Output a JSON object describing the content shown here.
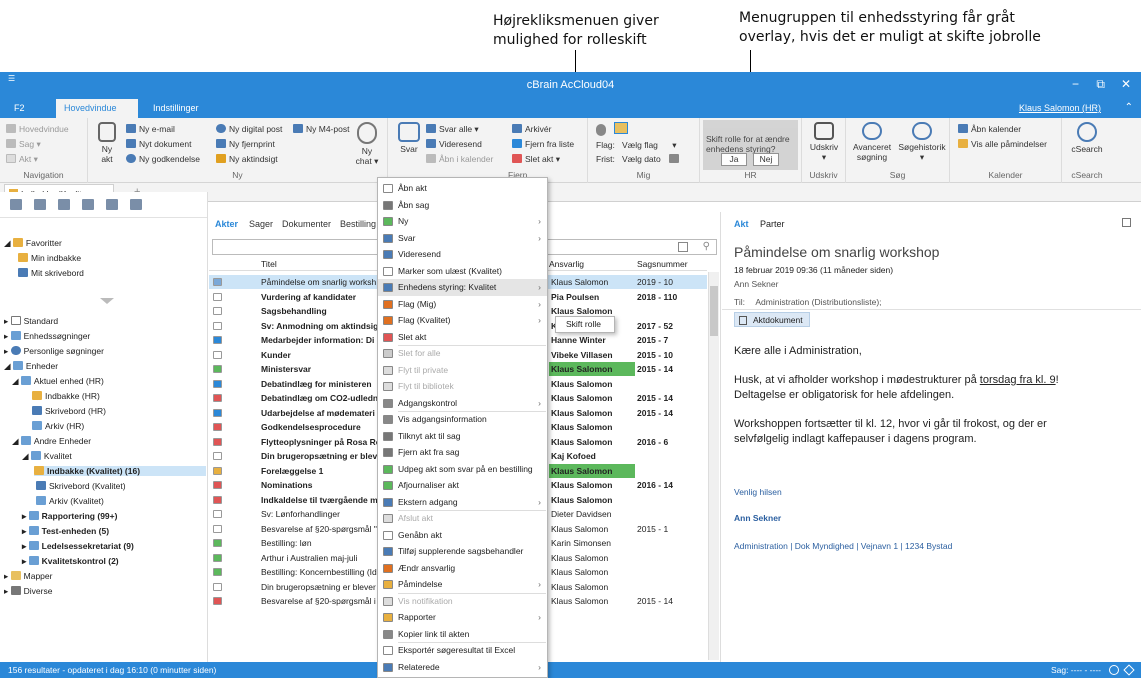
{
  "annotations": {
    "left_line1": "Højrekliksmenuen giver",
    "left_line2": "mulighed for rolleskift",
    "right_line1": "Menugruppen til enhedsstyring får gråt",
    "right_line2": "overlay, hvis det er muligt at skifte jobrolle"
  },
  "window": {
    "title": "cBrain AcCloud04",
    "quick_access": "☰",
    "min": "−",
    "restore": "⧉",
    "close": "✕",
    "collapse": "⌃"
  },
  "tabs": {
    "f2": "F2",
    "hoved": "Hovedvindue",
    "indst": "Indstillinger"
  },
  "user": "Klaus Salomon (HR)",
  "ribbon": {
    "navigation": {
      "label": "Navigation",
      "hovedvindue": "Hovedvindue",
      "sag": "Sag ▾",
      "akt": "Akt ▾"
    },
    "ny": {
      "label": "Ny",
      "ny_akt": "Ny\nakt",
      "email": "Ny e-mail",
      "dokument": "Nyt dokument",
      "godkendelse": "Ny godkendelse",
      "digital": "Ny digital post",
      "m4": "Ny M4-post",
      "fjernprint": "Ny fjernprint",
      "aktindsigt": "Ny aktindsigt",
      "chat": "Ny\nchat ▾"
    },
    "svar": {
      "svar": "Svar",
      "svar_alle": "Svar alle ▾",
      "videresend": "Videresend",
      "aaben_kalender": "Åbn i kalender",
      "arkiver": "Arkivér",
      "fjern_liste": "Fjern fra liste",
      "slet": "Slet akt ▾",
      "fjern": "Fjern"
    },
    "mig": {
      "label": "Mig",
      "flag": "Flag:",
      "vaelg_flag": "Vælg flag",
      "frist": "Frist:",
      "vaelg_dato": "Vælg dato"
    },
    "hr": {
      "label": "HR",
      "text": "Skift rolle for at ændre enhedens styring?",
      "ja": "Ja",
      "nej": "Nej"
    },
    "udskriv": {
      "label": "Udskriv",
      "btn": "Udskriv\n▾"
    },
    "soeg": {
      "label": "Søg",
      "avanceret": "Avanceret\nsøgning",
      "historik": "Søgehistorik\n▾"
    },
    "kalender": {
      "label": "Kalender",
      "aaben": "Åbn kalender",
      "vis": "Vis alle påmindelser"
    },
    "csearch": {
      "label": "cSearch",
      "btn": "cSearch"
    }
  },
  "doc_tab": "Indbakke (Kvalite...",
  "doc_tab_add": "+",
  "tree": {
    "favoritter": "Favoritter",
    "min_indbakke": "Min indbakke",
    "mit_skrivebord": "Mit skrivebord",
    "standard": "Standard",
    "enhedssoegninger": "Enhedssøgninger",
    "personlige": "Personlige søgninger",
    "enheder": "Enheder",
    "aktuel": "Aktuel enhed (HR)",
    "indbakke_hr": "Indbakke (HR)",
    "skrivebord_hr": "Skrivebord (HR)",
    "arkiv_hr": "Arkiv (HR)",
    "andre": "Andre Enheder",
    "kvalitet": "Kvalitet",
    "indbakke_k": "Indbakke (Kvalitet) (16)",
    "skrivebord_k": "Skrivebord (Kvalitet)",
    "arkiv_k": "Arkiv (Kvalitet)",
    "rapportering": "Rapportering (99+)",
    "test": "Test-enheden (5)",
    "ledelse": "Ledelsessekretariat (9)",
    "kvalitetskontrol": "Kvalitetskontrol (2)",
    "mapper": "Mapper",
    "diverse": "Diverse"
  },
  "mid": {
    "tabs": [
      "Akter",
      "Sager",
      "Dokumenter",
      "Bestilling"
    ],
    "col_titel": "Titel",
    "col_ansvarlig": "Ansvarlig",
    "col_sagsnr": "Sagsnummer",
    "rows": [
      {
        "title": "Påmindelse om snarlig worksh",
        "resp": "Klaus Salomon",
        "case": "2019 - 10"
      },
      {
        "title": "Vurdering af kandidater",
        "resp": "Pia Poulsen",
        "case": "2018 - 110"
      },
      {
        "title": "Sagsbehandling",
        "resp": "Klaus Salomon",
        "case": ""
      },
      {
        "title": "Sv: Anmodning om aktindsigt",
        "resp": "Klaus Salomon",
        "case": "2017 - 52"
      },
      {
        "title": "Medarbejder information: Di",
        "resp": "Hanne Winter",
        "case": "2015 - 7"
      },
      {
        "title": "Kunder",
        "resp": "Vibeke Villasen",
        "case": "2015 - 10"
      },
      {
        "title": "Ministersvar",
        "resp": "Klaus Salomon",
        "case": "2015 - 14"
      },
      {
        "title": "Debatindlæg for ministeren",
        "resp": "Klaus Salomon",
        "case": ""
      },
      {
        "title": "Debatindlæg om CO2-udledn",
        "resp": "Klaus Salomon",
        "case": "2015 - 14"
      },
      {
        "title": "Udarbejdelse af mødemateri",
        "resp": "Klaus Salomon",
        "case": "2015 - 14"
      },
      {
        "title": "Godkendelsesprocedure",
        "resp": "Klaus Salomon",
        "case": ""
      },
      {
        "title": "Flytteoplysninger på Rosa Ro",
        "resp": "Klaus Salomon",
        "case": "2016 - 6"
      },
      {
        "title": "Din brugeropsætning er blev",
        "resp": "Kaj Kofoed",
        "case": ""
      },
      {
        "title": "Forelæggelse 1",
        "resp": "Klaus Salomon",
        "case": ""
      },
      {
        "title": "Nominations",
        "resp": "Klaus Salomon",
        "case": "2016 - 14"
      },
      {
        "title": "Indkaldelse til tværgående m",
        "resp": "Klaus Salomon",
        "case": ""
      },
      {
        "title": "Sv: Lønforhandlinger",
        "resp": "Dieter Davidsen",
        "case": ""
      },
      {
        "title": "Besvarelse af §20-spørgsmål \"1",
        "resp": "Klaus Salomon",
        "case": "2015 - 1"
      },
      {
        "title": "Bestilling: løn",
        "resp": "Karin Simonsen",
        "case": ""
      },
      {
        "title": "Arthur i Australien maj-juli",
        "resp": "Klaus Salomon",
        "case": ""
      },
      {
        "title": "Bestilling: Koncernbestilling (Id",
        "resp": "Klaus Salomon",
        "case": ""
      },
      {
        "title": "Din brugeropsætning er blever",
        "resp": "Klaus Salomon",
        "case": ""
      },
      {
        "title": "Besvarelse af §20-spørgsmål i",
        "resp": "Klaus Salomon",
        "case": "2015 - 14"
      }
    ]
  },
  "right": {
    "tab_akt": "Akt",
    "tab_parter": "Parter",
    "subject": "Påmindelse om snarlig workshop",
    "date": "18 februar 2019 09:36 (11 måneder siden)",
    "sender": "Ann Sekner",
    "til_label": "Til:",
    "til_value": "Administration (Distributionsliste);",
    "attachment": "Aktdokument",
    "greeting": "Kære alle i Administration,",
    "p1a": "Husk, at vi afholder workshop i mødestrukturer på ",
    "p1link": "torsdag fra kl. 9",
    "p1b": "!",
    "p1c": "Deltagelse er obligatorisk for hele afdelingen.",
    "p2a": "Workshoppen fortsætter til kl. 12, hvor vi går til frokost, og der er",
    "p2b": "selvfølgelig indlagt kaffepauser i dagens program.",
    "regards": "Venlig hilsen",
    "name": "Ann Sekner",
    "footer": "Administration  |  Dok Myndighed  |  Vejnavn 1  |  1234 Bystad"
  },
  "status": {
    "left": "156 resultater - opdateret i dag 16:10 (0 minutter siden)",
    "right": "Sag: ---- - ----"
  },
  "context_menu": [
    {
      "label": "Åbn akt",
      "sub": false,
      "dis": false,
      "icon": "open-icon"
    },
    {
      "label": "Åbn sag",
      "sub": false,
      "dis": false,
      "icon": "case-icon"
    },
    {
      "label": "Ny",
      "sub": true,
      "dis": false,
      "icon": "plus-icon"
    },
    {
      "label": "Svar",
      "sub": true,
      "dis": false,
      "icon": "reply-icon"
    },
    {
      "label": "Videresend",
      "sub": false,
      "dis": false,
      "icon": "forward-icon"
    },
    {
      "label": "Marker som ulæst (Kvalitet)",
      "sub": false,
      "dis": false,
      "icon": "envelope-icon"
    },
    {
      "label": "Enhedens styring: Kvalitet",
      "sub": true,
      "dis": false,
      "icon": "unit-icon",
      "hl": true
    },
    {
      "label": "Flag (Mig)",
      "sub": true,
      "dis": false,
      "icon": "flag-icon"
    },
    {
      "label": "Flag (Kvalitet)",
      "sub": true,
      "dis": false,
      "icon": "flag-icon"
    },
    {
      "label": "Slet akt",
      "sub": false,
      "dis": false,
      "icon": "delete-icon"
    },
    {
      "label": "Slet for alle",
      "sub": false,
      "dis": true,
      "icon": "delete-all-icon"
    },
    {
      "label": "Flyt til private",
      "sub": false,
      "dis": true,
      "icon": "move-icon"
    },
    {
      "label": "Flyt til bibliotek",
      "sub": false,
      "dis": true,
      "icon": "library-icon"
    },
    {
      "label": "Adgangskontrol",
      "sub": true,
      "dis": false,
      "icon": "key-icon"
    },
    {
      "label": "Vis adgangsinformation",
      "sub": false,
      "dis": false,
      "icon": "key-icon"
    },
    {
      "label": "Tilknyt akt til sag",
      "sub": false,
      "dis": false,
      "icon": "attach-icon"
    },
    {
      "label": "Fjern akt fra sag",
      "sub": false,
      "dis": false,
      "icon": "detach-icon"
    },
    {
      "label": "Udpeg akt som svar på en bestilling",
      "sub": false,
      "dis": false,
      "icon": "order-icon"
    },
    {
      "label": "Afjournaliser akt",
      "sub": false,
      "dis": false,
      "icon": "unjournal-icon"
    },
    {
      "label": "Ekstern adgang",
      "sub": true,
      "dis": false,
      "icon": "external-icon"
    },
    {
      "label": "Afslut akt",
      "sub": false,
      "dis": true,
      "icon": "finish-icon"
    },
    {
      "label": "Genåbn akt",
      "sub": false,
      "dis": false,
      "icon": "reopen-icon"
    },
    {
      "label": "Tilføj supplerende sagsbehandler",
      "sub": false,
      "dis": false,
      "icon": "add-user-icon"
    },
    {
      "label": "Ændr ansvarlig",
      "sub": false,
      "dis": false,
      "icon": "user-icon"
    },
    {
      "label": "Påmindelse",
      "sub": true,
      "dis": false,
      "icon": "reminder-icon"
    },
    {
      "label": "Vis notifikation",
      "sub": false,
      "dis": true,
      "icon": "info-icon"
    },
    {
      "label": "Rapporter",
      "sub": true,
      "dis": false,
      "icon": "report-icon"
    },
    {
      "label": "Kopier link til akten",
      "sub": false,
      "dis": false,
      "icon": "link-icon"
    },
    {
      "label": "Eksportér søgeresultat til Excel",
      "sub": false,
      "dis": false,
      "icon": "excel-icon"
    },
    {
      "label": "Relaterede",
      "sub": true,
      "dis": false,
      "icon": "related-icon"
    }
  ],
  "submenu": {
    "label": "Skift rolle"
  },
  "colors": {
    "accent": "#2b88d8",
    "selection": "#cce4f7",
    "green": "#5cb85c",
    "red": "#e05555"
  }
}
